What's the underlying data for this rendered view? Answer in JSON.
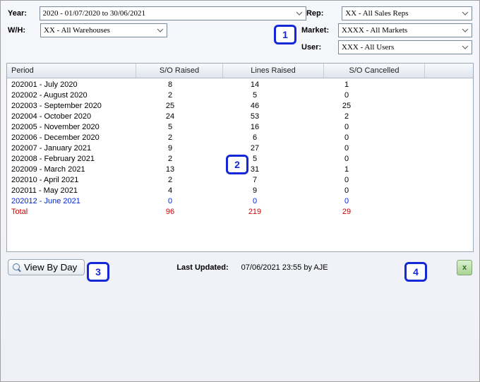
{
  "filters": {
    "year_label": "Year:",
    "year_value": "2020 - 01/07/2020 to 30/06/2021",
    "wh_label": "W/H:",
    "wh_value": "XX - All Warehouses",
    "rep_label": "Rep:",
    "rep_value": "XX - All Sales Reps",
    "market_label": "Market:",
    "market_value": "XXXX - All Markets",
    "user_label": "User:",
    "user_value": "XXX - All Users"
  },
  "columns": {
    "period": "Period",
    "so": "S/O Raised",
    "lines": "Lines Raised",
    "canc": "S/O Cancelled"
  },
  "rows": [
    {
      "period": "202001 - July 2020",
      "so": "8",
      "lines": "14",
      "canc": "1",
      "cls": ""
    },
    {
      "period": "202002 - August 2020",
      "so": "2",
      "lines": "5",
      "canc": "0",
      "cls": ""
    },
    {
      "period": "202003 - September 2020",
      "so": "25",
      "lines": "46",
      "canc": "25",
      "cls": ""
    },
    {
      "period": "202004 - October 2020",
      "so": "24",
      "lines": "53",
      "canc": "2",
      "cls": ""
    },
    {
      "period": "202005 - November 2020",
      "so": "5",
      "lines": "16",
      "canc": "0",
      "cls": ""
    },
    {
      "period": "202006 - December 2020",
      "so": "2",
      "lines": "6",
      "canc": "0",
      "cls": ""
    },
    {
      "period": "202007 - January 2021",
      "so": "9",
      "lines": "27",
      "canc": "0",
      "cls": ""
    },
    {
      "period": "202008 - February 2021",
      "so": "2",
      "lines": "5",
      "canc": "0",
      "cls": ""
    },
    {
      "period": "202009 - March 2021",
      "so": "13",
      "lines": "31",
      "canc": "1",
      "cls": ""
    },
    {
      "period": "202010 - April 2021",
      "so": "2",
      "lines": "7",
      "canc": "0",
      "cls": ""
    },
    {
      "period": "202011 - May 2021",
      "so": "4",
      "lines": "9",
      "canc": "0",
      "cls": ""
    },
    {
      "period": "202012 - June 2021",
      "so": "0",
      "lines": "0",
      "canc": "0",
      "cls": "row-current"
    },
    {
      "period": "Total",
      "so": "96",
      "lines": "219",
      "canc": "29",
      "cls": "row-total"
    }
  ],
  "footer": {
    "view_by_day": "View By Day",
    "last_updated_label": "Last Updated:",
    "last_updated_value": "07/06/2021 23:55 by AJE",
    "excel_glyph": "x"
  },
  "callouts": {
    "c1": "1",
    "c2": "2",
    "c3": "3",
    "c4": "4"
  }
}
